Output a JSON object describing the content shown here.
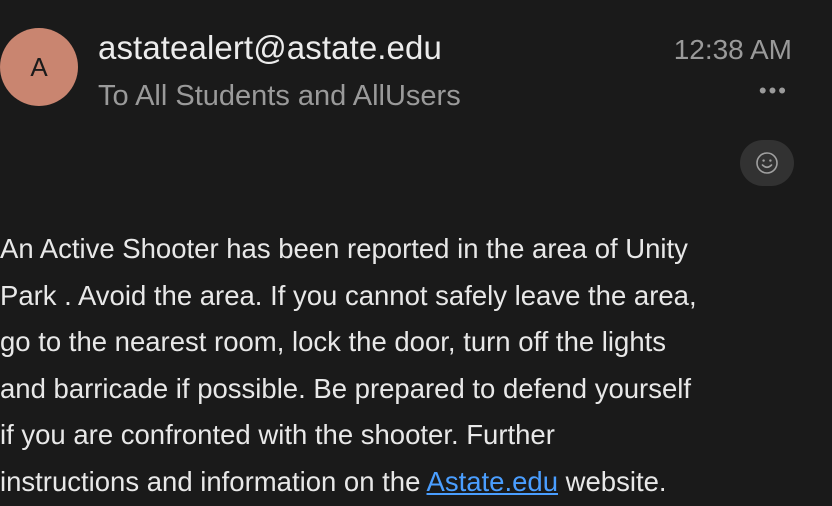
{
  "email": {
    "avatar_initial": "A",
    "sender": "astatealert@astate.edu",
    "recipients": "To All Students and AllUsers",
    "time": "12:38 AM",
    "more_icon": "•••",
    "react_icon": "smiley-icon"
  },
  "body": {
    "line1": "An Active Shooter has been reported in the area of Unity",
    "line2": "Park .  Avoid the area.  If you cannot safely leave the area,",
    "line3": "go to the nearest room, lock the door, turn off the lights",
    "line4": "and barricade if possible.  Be prepared to defend yourself",
    "line5": "if you are confronted with the shooter.  Further",
    "line6_before": "instructions and information on the ",
    "line6_link": "Astate.edu",
    "line6_after": " website."
  },
  "colors": {
    "background": "#1a1a1a",
    "avatar": "#c98570",
    "link": "#4a9eff"
  }
}
